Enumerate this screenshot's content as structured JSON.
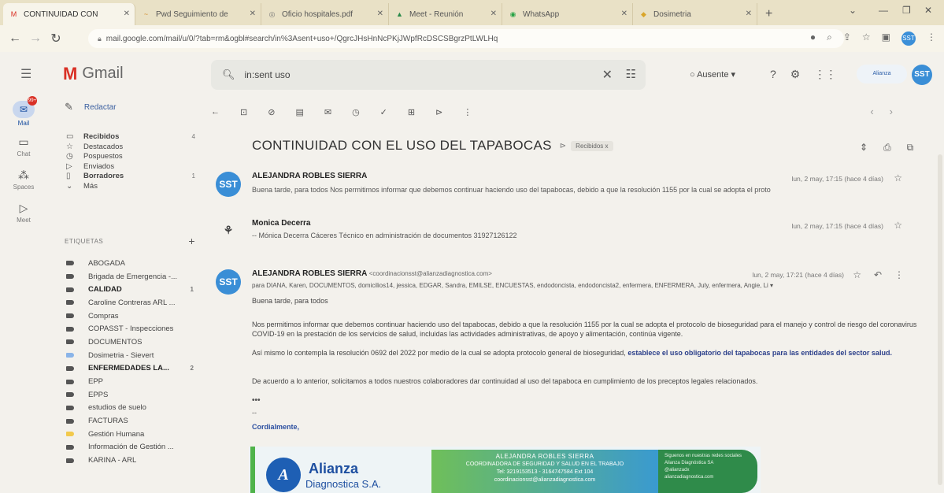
{
  "browser": {
    "tabs": [
      {
        "icon": "M",
        "label": "CONTINUIDAD CON",
        "active": true
      },
      {
        "icon": "~",
        "label": "Pwd Seguimiento de",
        "active": false
      },
      {
        "icon": "◎",
        "label": "Oficio hospitales.pdf",
        "active": false
      },
      {
        "icon": "▲",
        "label": "Meet - Reunión",
        "active": false
      },
      {
        "icon": "◉",
        "label": "WhatsApp",
        "active": false
      },
      {
        "icon": "◆",
        "label": "Dosimetria",
        "active": false
      }
    ],
    "url": "mail.google.com/mail/u/0/?tab=rm&ogbl#search/in%3Asent+uso+/QgrcJHsHnNcPKjJWpfRcDSCSBgrzPtLWLHq"
  },
  "header": {
    "app_name": "Gmail",
    "search_value": "in:sent uso",
    "status": "Ausente",
    "brand_mini": "Alianza",
    "avatar": "SST"
  },
  "rail": [
    {
      "label": "Mail",
      "badge": "99+"
    },
    {
      "label": "Chat"
    },
    {
      "label": "Spaces"
    },
    {
      "label": "Meet"
    }
  ],
  "sidebar": {
    "compose": "Redactar",
    "folders": [
      {
        "label": "Recibidos",
        "count": "4",
        "bold": true
      },
      {
        "label": "Destacados",
        "count": "",
        "bold": false
      },
      {
        "label": "Pospuestos",
        "count": "",
        "bold": false
      },
      {
        "label": "Enviados",
        "count": "",
        "bold": false
      },
      {
        "label": "Borradores",
        "count": "1",
        "bold": true
      },
      {
        "label": "Más",
        "count": "",
        "bold": false
      }
    ],
    "labels_title": "ETIQUETAS",
    "labels": [
      {
        "label": "ABOGADA",
        "count": "",
        "bold": false
      },
      {
        "label": "Brigada de Emergencia -...",
        "count": "",
        "bold": false
      },
      {
        "label": "CALIDAD",
        "count": "1",
        "bold": true
      },
      {
        "label": "Caroline Contreras ARL ...",
        "count": "",
        "bold": false
      },
      {
        "label": "Compras",
        "count": "",
        "bold": false
      },
      {
        "label": "COPASST - Inspecciones",
        "count": "",
        "bold": false
      },
      {
        "label": "DOCUMENTOS",
        "count": "",
        "bold": false
      },
      {
        "label": "Dosimetria - Sievert",
        "count": "",
        "bold": false
      },
      {
        "label": "ENFERMEDADES LA...",
        "count": "2",
        "bold": true
      },
      {
        "label": "EPP",
        "count": "",
        "bold": false
      },
      {
        "label": "EPPS",
        "count": "",
        "bold": false
      },
      {
        "label": "estudios de suelo",
        "count": "",
        "bold": false
      },
      {
        "label": "FACTURAS",
        "count": "",
        "bold": false
      },
      {
        "label": "Gestión Humana",
        "count": "",
        "bold": false
      },
      {
        "label": "Información de Gestión ...",
        "count": "",
        "bold": false
      },
      {
        "label": "KARINA - ARL",
        "count": "",
        "bold": false
      }
    ]
  },
  "thread": {
    "subject": "CONTINUIDAD CON EL USO DEL TAPABOCAS",
    "chip": "Recibidos x",
    "messages": [
      {
        "avatar": "SST",
        "sender": "ALEJANDRA ROBLES SIERRA",
        "date": "lun, 2 may, 17:15 (hace 4 días)",
        "snippet": "Buena tarde, para todos Nos permitimos informar que debemos continuar haciendo uso del tapabocas, debido a que la resolución 1155 por la cual se adopta el proto"
      },
      {
        "avatar": "⚘",
        "sender": "Monica Decerra",
        "date": "lun, 2 may, 17:15 (hace 4 días)",
        "snippet": "-- Mónica Decerra Cáceres Técnico en administración de documentos 3192712612​2"
      }
    ],
    "open_message": {
      "avatar": "SST",
      "sender": "ALEJANDRA ROBLES SIERRA",
      "email": "<coordinacionsst@alianzadiagnostica.com>",
      "date": "lun, 2 may, 17:21 (hace 4 días)",
      "to": "para DIANA, Karen, DOCUMENTOS, domicilios14, jessica, EDGAR, Sandra, EMILSE, ENCUESTAS, endodoncista, endodoncista2, enfermera, ENFERMERA, July, enfermera, Angie, Li ▾",
      "greeting": "Buena tarde, para todos",
      "para1": "Nos permitimos informar que debemos continuar haciendo uso del tapabocas, debido a que la resolución 1155 por la cual se adopta el protocolo de bioseguridad para el manejo y control de riesgo del coronavirus COVID-19 en la prestación de los servicios de salud, incluidas las actividades administrativas, de apoyo y alimentación, continúa vigente.",
      "para2_a": "Así mismo lo contempla la resolución 0692 del 2022 por medio de la cual se adopta protocolo general de bioseguridad,",
      "para2_b": "establece el uso obligatorio del tapabocas para las entidades del sector salud.",
      "para3": "De acuerdo a lo anterior, solicitamos a todos nuestros colaboradores dar continuidad al uso del tapaboca en cumplimiento de los preceptos legales relacionados.",
      "ellipsis": "•••",
      "dash": "--",
      "closing": "Cordialmente,"
    }
  },
  "signature": {
    "brand_line1": "Alianza",
    "brand_line2": "Diagnostica S.A.",
    "name": "ALEJANDRA ROBLES SIERRA",
    "role": "COORDINADORA DE SEGURIDAD Y SALUD EN EL TRABAJO",
    "phone": "Tel: 3219153513 - 3164747584 Ext 104",
    "email": "coordinacionsst@alianzadiagnostica.com",
    "right_title": "Siguenos en nuestras redes sociales",
    "right_1": "Alianza Diagnóstica SA",
    "right_2": "@alianzadx",
    "right_3": "alianzadiagnostica.com"
  },
  "colors": {
    "accent": "#1e5fb4",
    "gmail_red": "#d93025",
    "sig_green": "#4fb34a"
  }
}
